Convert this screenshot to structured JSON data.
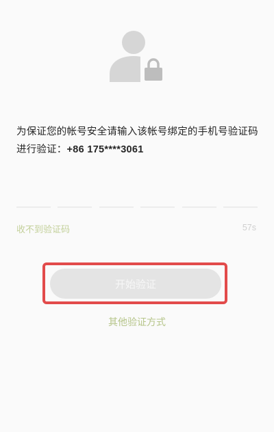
{
  "verification": {
    "icon": "user-lock-icon",
    "message_prefix": "为保证您的帐号安全请输入该帐号绑定的手机号验证码进行验证：",
    "phone": "+86 175****3061",
    "code_box_count": 6,
    "no_code_label": "收不到验证码",
    "countdown": "57s",
    "start_button_label": "开始验证",
    "other_method_label": "其他验证方式"
  },
  "colors": {
    "accent": "#b6c58a",
    "highlight": "#e24b4b",
    "button_disabled": "#e4e4e4"
  }
}
